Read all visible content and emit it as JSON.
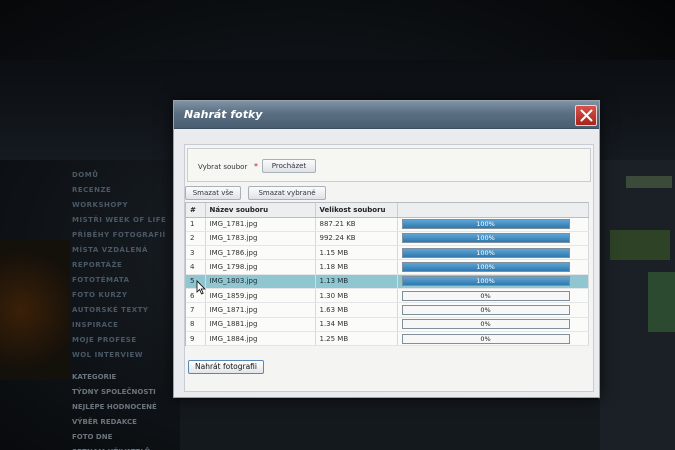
{
  "background_site": {
    "menu_items": [
      "DOMŮ",
      "RECENZE",
      "WORKSHOPY",
      "MISTŘI WEEK OF LIFE",
      "PŘÍBĚHY FOTOGRAFIÍ",
      "MÍSTA VZDÁLENÁ",
      "REPORTÁŽE",
      "FOTOTÉMATA",
      "FOTO KURZY",
      "AUTORSKÉ TEXTY",
      "INSPIRACE",
      "MOJE PROFESE",
      "WOL INTERVIEW"
    ],
    "menu2_items": [
      "KATEGORIE",
      "TÝDNY SPOLEČNOSTI",
      "NEJLÉPE HODNOCENÉ",
      "VÝBĚR REDAKCE",
      "FOTO DNE",
      "SEZNAM UŽIVATELŮ"
    ]
  },
  "dialog": {
    "title": "Nahrát fotky",
    "select_file_label": "Vybrat soubor",
    "required_marker": "*",
    "browse_label": "Procházet",
    "delete_all_label": "Smazat vše",
    "delete_selected_label": "Smazat vybrané",
    "upload_label": "Nahrát fotografii",
    "table": {
      "headers": [
        "#",
        "Název souboru",
        "Velikost souboru",
        ""
      ],
      "rows": [
        {
          "num": "1",
          "name": "IMG_1781.jpg",
          "size": "887.21 KB",
          "progress": 100,
          "progress_label": "100%"
        },
        {
          "num": "2",
          "name": "IMG_1783.jpg",
          "size": "992.24 KB",
          "progress": 100,
          "progress_label": "100%"
        },
        {
          "num": "3",
          "name": "IMG_1786.jpg",
          "size": "1.15 MB",
          "progress": 100,
          "progress_label": "100%"
        },
        {
          "num": "4",
          "name": "IMG_1798.jpg",
          "size": "1.18 MB",
          "progress": 100,
          "progress_label": "100%"
        },
        {
          "num": "5",
          "name": "IMG_1803.jpg",
          "size": "1.13 MB",
          "progress": 100,
          "progress_label": "100%"
        },
        {
          "num": "6",
          "name": "IMG_1859.jpg",
          "size": "1.30 MB",
          "progress": 0,
          "progress_label": "0%"
        },
        {
          "num": "7",
          "name": "IMG_1871.jpg",
          "size": "1.63 MB",
          "progress": 0,
          "progress_label": "0%"
        },
        {
          "num": "8",
          "name": "IMG_1881.jpg",
          "size": "1.34 MB",
          "progress": 0,
          "progress_label": "0%"
        },
        {
          "num": "9",
          "name": "IMG_1884.jpg",
          "size": "1.25 MB",
          "progress": 0,
          "progress_label": "0%"
        }
      ],
      "selected_row": "5"
    }
  },
  "colors": {
    "titlebar": "#5b6f83",
    "close_button": "#c0392b",
    "progress_fill": "#2f79b1",
    "selected_row": "#8fc6cf"
  },
  "icons": {
    "close": "close-x-icon",
    "cursor": "mouse-pointer-icon"
  }
}
